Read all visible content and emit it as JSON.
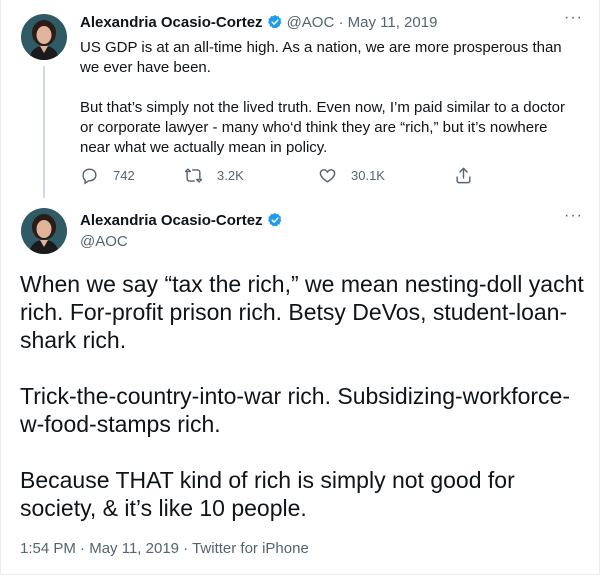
{
  "tweet1": {
    "display_name": "Alexandria Ocasio-Cortez",
    "handle": "@AOC",
    "separator": "·",
    "date": "May 11, 2019",
    "more_icon": "more-icon",
    "para1": "US GDP is at an all-time high. As a nation, we are more prosperous than we ever have been.",
    "para2": "But that’s simply not the lived truth. Even now, I’m paid similar to a doctor or corporate lawyer - many who‘d think they are “rich,” but it’s nowhere near what we actually mean in policy.",
    "replies": "742",
    "retweets": "3.2K",
    "likes": "30.1K",
    "icons": [
      "reply-icon",
      "retweet-icon",
      "like-icon",
      "share-icon"
    ]
  },
  "tweet2": {
    "display_name": "Alexandria Ocasio-Cortez",
    "handle": "@AOC",
    "para1": "When we say “tax the rich,” we mean nesting-doll yacht rich. For-profit prison rich. Betsy DeVos, student-loan-shark rich.",
    "para2": "Trick-the-country-into-war rich. Subsidizing-workforce-w-food-stamps rich.",
    "para3": "Because THAT kind of rich is simply not good for society, & it’s like 10 people.",
    "time": "1:54 PM",
    "separator": "·",
    "date": "May 11, 2019",
    "source": "Twitter for iPhone"
  },
  "colors": {
    "verified": "#1d9bf0",
    "muted": "#536471",
    "text": "#0f1419"
  }
}
